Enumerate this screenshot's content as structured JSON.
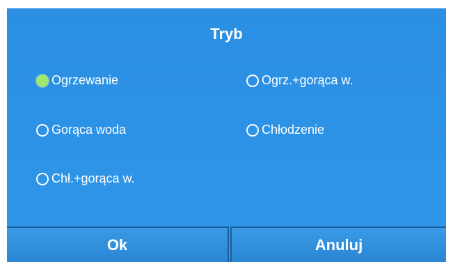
{
  "dialog": {
    "title": "Tryb"
  },
  "options": [
    {
      "label": "Ogrzewanie",
      "selected": true
    },
    {
      "label": "Ogrz.+gorąca w.",
      "selected": false
    },
    {
      "label": "Gorąca woda",
      "selected": false
    },
    {
      "label": "Chłodzenie",
      "selected": false
    },
    {
      "label": "Chł.+gorąca w.",
      "selected": false
    }
  ],
  "buttons": {
    "ok_label": "Ok",
    "cancel_label": "Anuluj"
  },
  "colors": {
    "background": "#2d93e6",
    "selected_radio": "#9ee870",
    "text": "#ffffff"
  }
}
